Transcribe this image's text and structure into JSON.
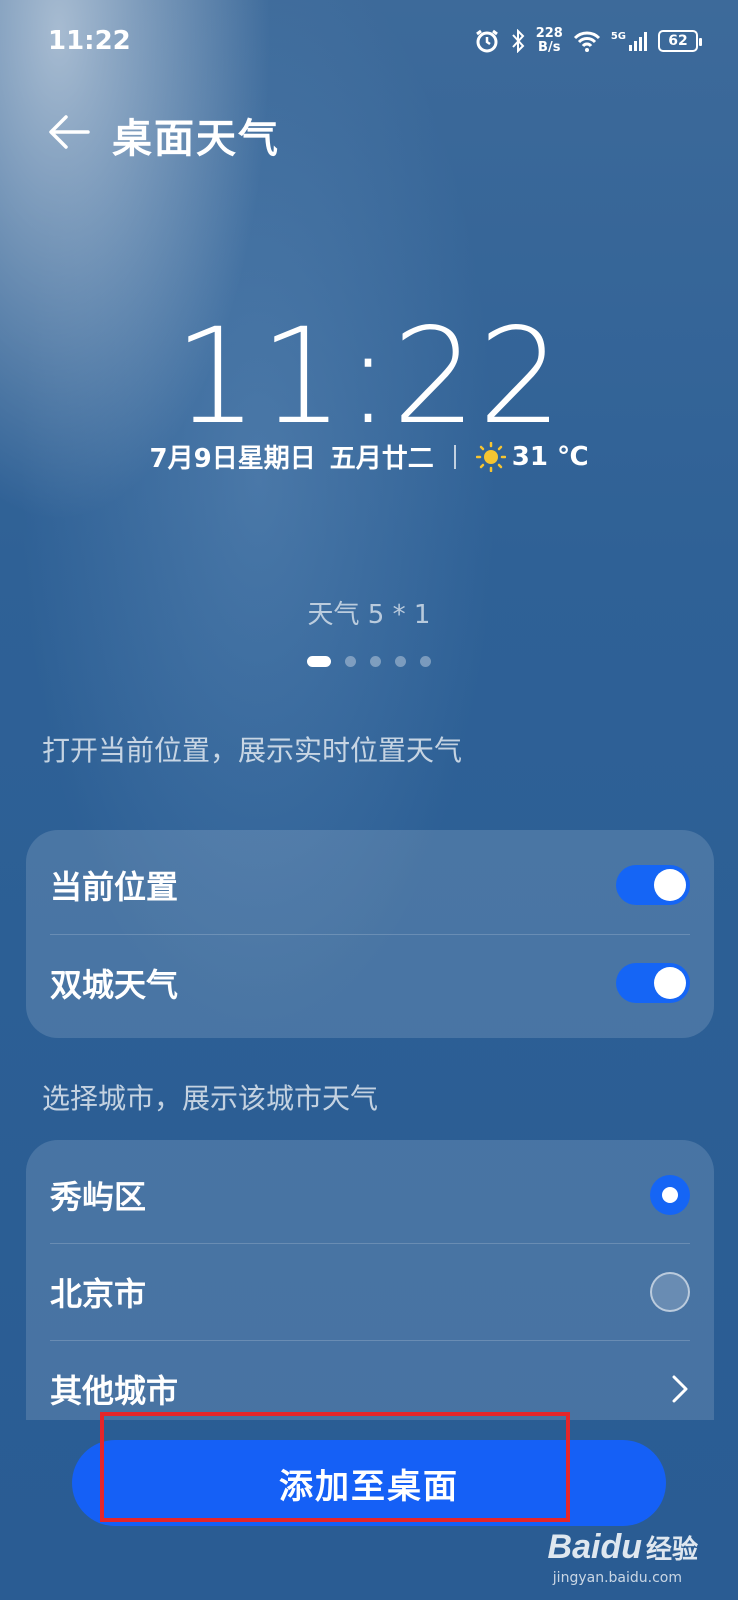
{
  "status": {
    "time": "11:22",
    "net_speed_value": "228",
    "net_speed_unit": "B/s",
    "signal_label": "5G",
    "battery": "62"
  },
  "header": {
    "title": "桌面天气"
  },
  "preview": {
    "clock": "11:22",
    "date": "7月9日星期日",
    "lunar": "五月廿二",
    "temperature": "31 ℃",
    "widget_name": "天气 5 * 1",
    "pages_total": 5,
    "page_active": 1
  },
  "location_section": {
    "label": "打开当前位置，展示实时位置天气",
    "items": [
      {
        "label": "当前位置",
        "on": true
      },
      {
        "label": "双城天气",
        "on": true
      }
    ]
  },
  "city_section": {
    "label": "选择城市，展示该城市天气",
    "items": [
      {
        "label": "秀屿区",
        "selected": true
      },
      {
        "label": "北京市",
        "selected": false
      },
      {
        "label": "其他城市"
      }
    ]
  },
  "add_button": "添加至桌面",
  "watermark": {
    "main": "Baidu",
    "sub": "经验",
    "url": "jingyan.baidu.com"
  },
  "colors": {
    "accent": "#1560f6",
    "highlight": "#e6262a"
  }
}
